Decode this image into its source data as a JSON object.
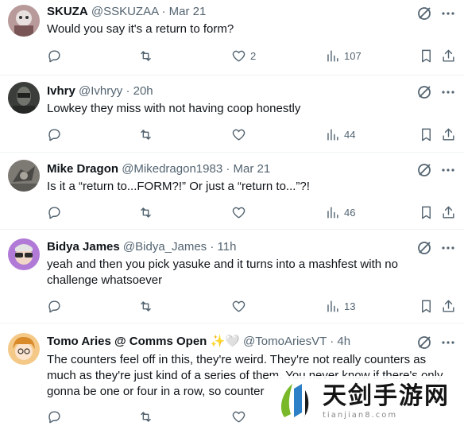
{
  "colors": {
    "text": "#0f1419",
    "muted": "#536471",
    "divider": "#eff3f4"
  },
  "tweets": [
    {
      "name": "SKUZA",
      "handle": "@SSKUZAA",
      "dot": "·",
      "time": "Mar 21",
      "text": "Would you say it's a return to form?",
      "likes": "2",
      "views": "107"
    },
    {
      "name": "Ivhry",
      "handle": "@Ivhryy",
      "dot": "·",
      "time": "20h",
      "text": "Lowkey they miss with not having coop honestly",
      "likes": "",
      "views": "44"
    },
    {
      "name": "Mike Dragon",
      "handle": "@Mikedragon1983",
      "dot": "·",
      "time": "Mar 21",
      "text": "Is it a “return to...FORM?!” Or just a “return to...”?!",
      "likes": "",
      "views": "46"
    },
    {
      "name": "Bidya James",
      "handle": "@Bidya_James",
      "dot": "·",
      "time": "11h",
      "text": "yeah and then you pick yasuke and it turns into a mashfest with no challenge whatsoever",
      "likes": "",
      "views": "13"
    },
    {
      "name": "Tomo Aries @ Comms Open",
      "emoji": "✨🤍",
      "handle": "@TomoAriesVT",
      "dot": "·",
      "time": "4h",
      "text": "The counters feel off in this, they're weird. They're not really counters as much as they're just kind of a series of them. You never know if there's only gonna be one or four in a row, so counter",
      "likes": "",
      "views": ""
    }
  ],
  "icons": {
    "reply": "reply-icon",
    "retweet": "retweet-icon",
    "like": "heart-icon",
    "views": "views-chart-icon",
    "bookmark": "bookmark-icon",
    "share": "share-icon",
    "grok": "grok-icon"
  },
  "watermark": {
    "main": "天剑手游网",
    "sub": "tianjian8.com"
  }
}
